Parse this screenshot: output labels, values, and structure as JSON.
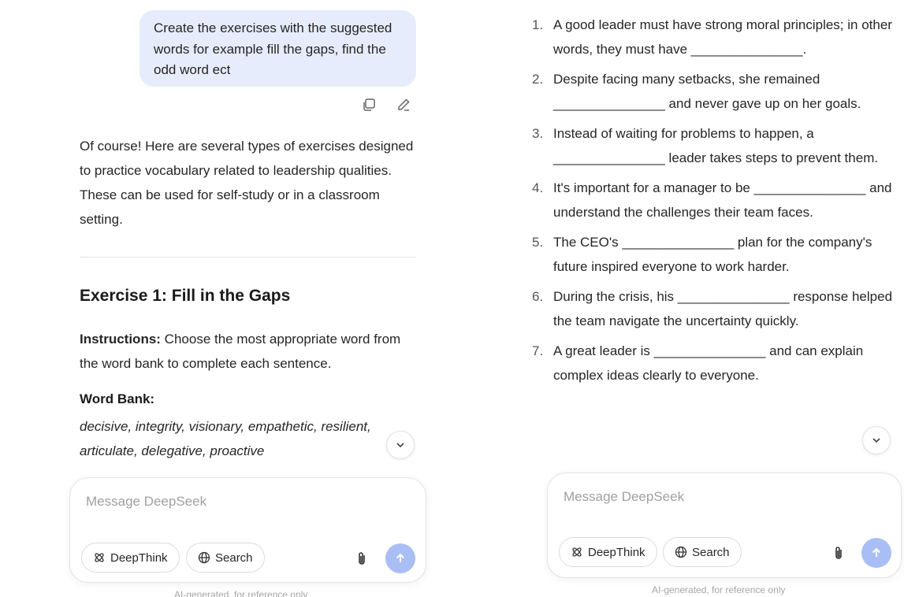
{
  "left": {
    "user_message": "Create the exercises with the suggested words for example fill the gaps, find the odd word ect",
    "assistant_intro": "Of course! Here are several types of exercises designed to practice vocabulary related to leadership qualities. These can be used for self-study or in a classroom setting.",
    "exercise_title": "Exercise 1: Fill in the Gaps",
    "instructions_label": "Instructions:",
    "instructions_text": " Choose the most appropriate word from the word bank to complete each sentence.",
    "word_bank_label": "Word Bank:",
    "word_bank": "decisive, integrity, visionary, empathetic, resilient, articulate, delegative, proactive"
  },
  "right": {
    "sentences": [
      {
        "num": "1.",
        "text": "A good leader must have strong moral principles; in other words, they must have _______________."
      },
      {
        "num": "2.",
        "text": "Despite facing many setbacks, she remained _______________ and never gave up on her goals."
      },
      {
        "num": "3.",
        "text": "Instead of waiting for problems to happen, a _______________ leader takes steps to prevent them."
      },
      {
        "num": "4.",
        "text": "It's important for a manager to be _______________ and understand the challenges their team faces."
      },
      {
        "num": "5.",
        "text": "The CEO's _______________ plan for the company's future inspired everyone to work harder."
      },
      {
        "num": "6.",
        "text": "During the crisis, his _______________ response helped the team navigate the uncertainty quickly."
      },
      {
        "num": "7.",
        "text": "A great leader is _______________ and can explain complex ideas clearly to everyone."
      }
    ]
  },
  "composer": {
    "placeholder": "Message DeepSeek",
    "deepthink_label": "DeepThink",
    "search_label": "Search"
  },
  "footer_note": "AI-generated, for reference only",
  "icons": {
    "copy": "copy-icon",
    "edit": "pencil-icon",
    "scroll": "chevron-down-icon",
    "deepthink": "atom-icon",
    "search": "globe-icon",
    "attach": "paperclip-icon",
    "send": "arrow-up-icon"
  },
  "colors": {
    "user_bubble": "#e6ecfb",
    "send_button": "#a9bef5",
    "placeholder": "#a0a0a0"
  }
}
